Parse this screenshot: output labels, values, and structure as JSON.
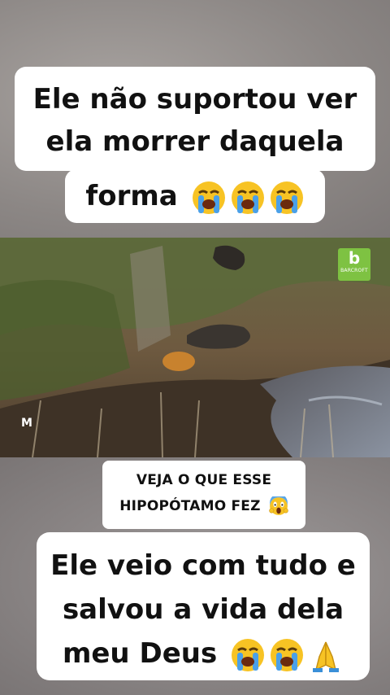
{
  "captions": {
    "top_line1": "Ele não suportou ver",
    "top_line2": "ela morrer daquela",
    "top_line3": "forma",
    "mid_line1": "VEJA O QUE ESSE",
    "mid_line2": "HIPOPÓTAMO FEZ",
    "bottom_line1": "Ele veio com tudo e",
    "bottom_line2": "salvou a vida dela",
    "bottom_line3": "meu Deus"
  },
  "emojis": {
    "top": [
      "loudly-crying-face",
      "loudly-crying-face",
      "loudly-crying-face"
    ],
    "mid": [
      "face-screaming-in-fear"
    ],
    "bottom": [
      "loudly-crying-face",
      "loudly-crying-face",
      "folded-hands"
    ]
  },
  "video": {
    "logo_letter": "b",
    "logo_text": "BARCROFT",
    "watermark": "M"
  },
  "colors": {
    "caption_bg": "#ffffff",
    "caption_text": "#111111",
    "logo_green": "#7ec242"
  }
}
